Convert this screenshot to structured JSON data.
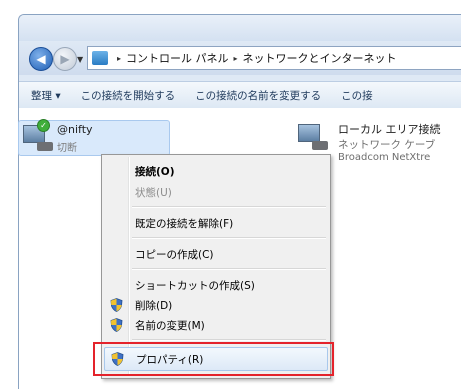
{
  "address": {
    "crumbs": [
      "コントロール パネル",
      "ネットワークとインターネット"
    ],
    "separator": "▸"
  },
  "toolbar": {
    "items": [
      "整理 ▾",
      "この接続を開始する",
      "この接続の名前を変更する",
      "この接"
    ]
  },
  "connections": [
    {
      "name": "@nifty",
      "status": "切断"
    },
    {
      "name": "ローカル エリア接続",
      "line2": "ネットワーク ケーブ",
      "line3": "Broadcom NetXtre"
    }
  ],
  "context_menu": {
    "items": [
      {
        "label": "接続(O)",
        "style": "bold",
        "shield": false
      },
      {
        "label": "状態(U)",
        "style": "disabled",
        "shield": false
      },
      {
        "label": "既定の接続を解除(F)",
        "style": "normal",
        "shield": false
      },
      {
        "label": "コピーの作成(C)",
        "style": "normal",
        "shield": false
      },
      {
        "label": "ショートカットの作成(S)",
        "style": "normal",
        "shield": false
      },
      {
        "label": "削除(D)",
        "style": "normal",
        "shield": true
      },
      {
        "label": "名前の変更(M)",
        "style": "normal",
        "shield": true
      },
      {
        "label": "プロパティ(R)",
        "style": "hot",
        "shield": true
      }
    ]
  },
  "colors": {
    "highlight_box": "#e4232b",
    "connected_check": "#3fae3a"
  }
}
